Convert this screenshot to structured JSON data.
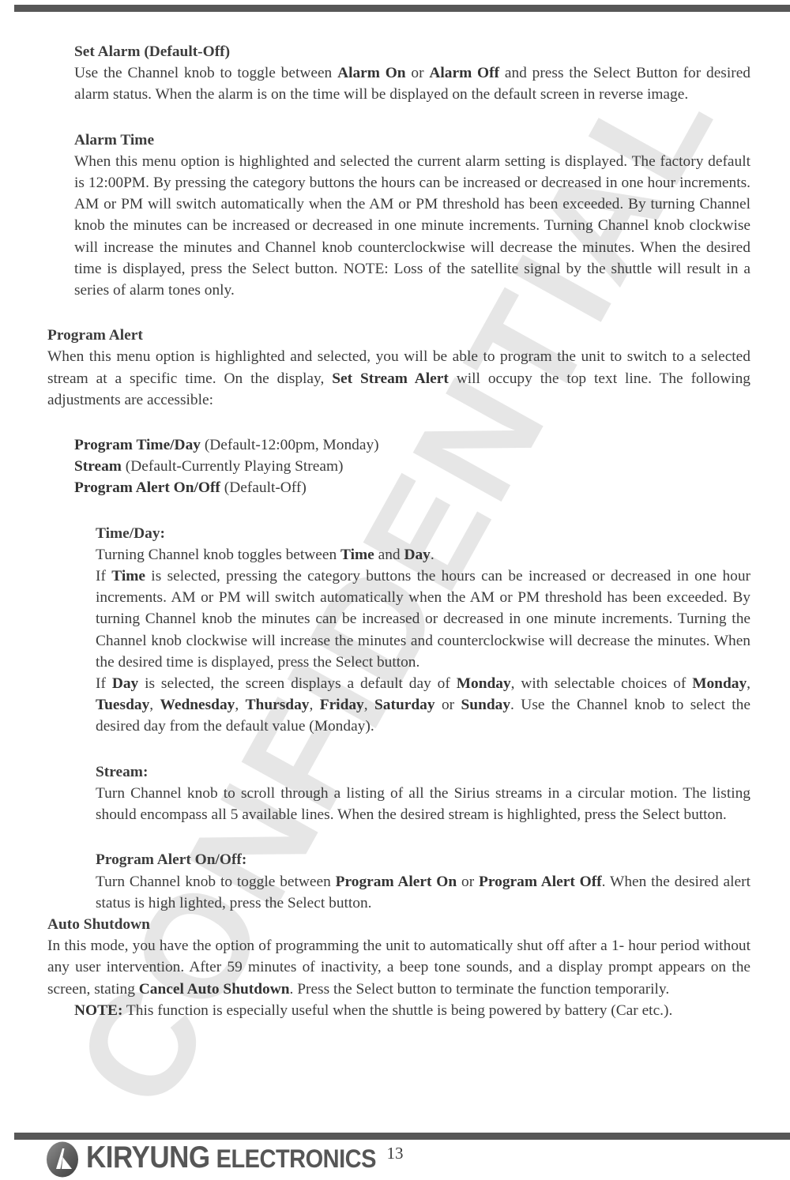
{
  "document": {
    "page_number": "13",
    "watermark": "CONFIDENTIAL"
  },
  "footer": {
    "logo_primary": "KIRYUNG",
    "logo_secondary": "ELECTRONICS",
    "logo_mark": "kiryung-circle-k-icon"
  },
  "sections": {
    "set_alarm": {
      "heading": "Set Alarm (Default-Off)",
      "body_1": "Use the Channel knob to toggle between ",
      "body_b1": "Alarm On",
      "body_2": " or ",
      "body_b2": "Alarm Off",
      "body_3": " and press the Select Button for desired alarm status. When the alarm is on the time will be displayed on the default screen in reverse image."
    },
    "alarm_time": {
      "heading": "Alarm Time",
      "body": "When this menu option is highlighted and selected the current alarm setting is displayed. The factory default is 12:00PM. By pressing the category buttons the hours can be increased or decreased in one hour increments. AM or PM will switch automatically when the AM or PM threshold has been exceeded. By turning Channel knob the minutes can be increased or decreased in one minute increments. Turning Channel knob clockwise will increase the minutes and Channel knob counterclockwise will decrease the minutes. When the desired time is displayed, press the Select button. NOTE: Loss of the satellite signal by the shuttle will result in a series of alarm tones only."
    },
    "program_alert": {
      "heading": "Program Alert",
      "body_1": "When this menu option is highlighted and selected, you will be able to program the unit to switch to a selected stream at a specific time. On the display, ",
      "body_b1": "Set Stream Alert",
      "body_2": " will occupy the top text line. The following adjustments are accessible:",
      "options": [
        {
          "label": "Program Time/Day",
          "value": " (Default-12:00pm, Monday)"
        },
        {
          "label": "Stream",
          "value": " (Default-Currently Playing Stream)"
        },
        {
          "label": "Program Alert On/Off",
          "value": " (Default-Off)"
        }
      ]
    },
    "time_day": {
      "heading": "Time/Day:",
      "line_1a": "Turning Channel knob toggles between ",
      "line_1b": "Time",
      "line_1c": " and ",
      "line_1d": "Day",
      "line_1e": ".",
      "line_2a": "If ",
      "line_2b": "Time",
      "line_2c": " is selected, pressing the category buttons the hours can be increased or decreased in one hour increments. AM or PM will switch automatically when the AM or PM threshold has been exceeded. By turning Channel knob the minutes can be increased or decreased in one minute increments. Turning the Channel knob clockwise will increase the minutes and counterclockwise will decrease the minutes. When the desired time is displayed, press the Select button.",
      "line_3a": "If ",
      "line_3b": "Day",
      "line_3c": " is selected, the screen displays a default day of ",
      "line_3d": "Monday",
      "line_3e": ", with selectable choices of ",
      "days": [
        "Monday",
        "Tuesday",
        "Wednesday",
        "Thursday",
        "Friday",
        "Saturday",
        "Sunday"
      ],
      "line_3f": ". Use the Channel knob to select the desired day from the default value (Monday).",
      "day_sep": ", ",
      "day_or": " or "
    },
    "stream": {
      "heading": "Stream:",
      "body": "Turn Channel knob to scroll through a listing of all the Sirius streams in a circular motion. The listing should encompass all 5 available lines. When the desired stream is highlighted, press the Select button."
    },
    "program_alert_onoff": {
      "heading": "Program Alert On/Off:",
      "body_1": "Turn Channel knob to toggle between ",
      "body_b1": "Program Alert On",
      "body_2": " or ",
      "body_b2": "Program Alert Off",
      "body_3": ". When the desired alert status is high lighted, press the Select button."
    },
    "auto_shutdown": {
      "heading": "Auto Shutdown",
      "body_1": "In this mode, you have the option of programming the unit to automatically shut off after a 1- hour period without any user intervention. After 59 minutes of inactivity, a beep tone sounds, and a display prompt appears on the screen, stating ",
      "body_b1": "Cancel Auto Shutdown",
      "body_2": ". Press the Select button to terminate the function temporarily.",
      "note_label": "NOTE:",
      "note_body": " This function is especially useful when the shuttle is being powered by battery (Car etc.)."
    }
  }
}
